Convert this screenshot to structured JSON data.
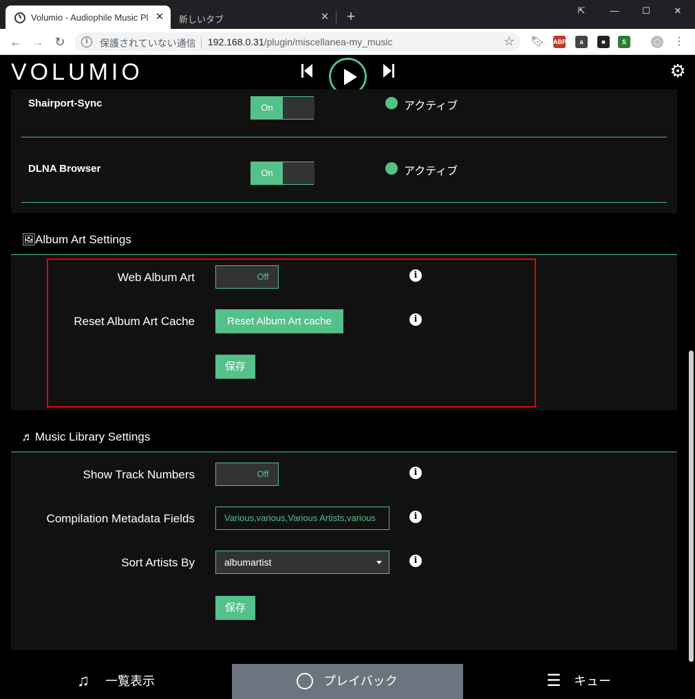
{
  "browser": {
    "tabs": [
      {
        "title": "Volumio - Audiophile Music Pl",
        "active": true
      },
      {
        "title": "新しいタブ",
        "active": false
      }
    ],
    "window_controls": {
      "cast": "⇱",
      "minimize": "—",
      "maximize": "☐",
      "close": "✕"
    },
    "address": {
      "security_label": "保護されていない通信",
      "host": "192.168.0.31",
      "path": "/plugin/miscellanea-my_music"
    },
    "extensions": [
      {
        "name": "abp-icon",
        "label": "ABP",
        "color": "#c0392b"
      },
      {
        "name": "amazon-icon",
        "label": "a",
        "color": "#444444"
      },
      {
        "name": "extension-dark-icon",
        "label": "■",
        "color": "#222222"
      },
      {
        "name": "s-extension-icon",
        "label": "S",
        "color": "#2e7d32"
      },
      {
        "name": "profile-icon",
        "label": "◯",
        "color": "#bdbdbd"
      }
    ]
  },
  "app": {
    "logo": "VOLUMIO",
    "accent": "#54c08a"
  },
  "services": [
    {
      "name": "Shairport-Sync",
      "toggle": "On",
      "status": "アクティブ"
    },
    {
      "name": "DLNA Browser",
      "toggle": "On",
      "status": "アクティブ"
    }
  ],
  "album_art": {
    "title": "Album Art Settings",
    "web_album_art": {
      "label": "Web Album Art",
      "toggle": "Off"
    },
    "reset_cache": {
      "label": "Reset Album Art Cache",
      "button": "Reset Album Art cache"
    },
    "save": "保存"
  },
  "music_library": {
    "title": "Music Library Settings",
    "show_track_numbers": {
      "label": "Show Track Numbers",
      "toggle": "Off"
    },
    "compilation": {
      "label": "Compilation Metadata Fields",
      "value": "Various,various,Various Artists,various"
    },
    "sort_artists": {
      "label": "Sort Artists By",
      "value": "albumartist"
    },
    "save": "保存"
  },
  "footer": {
    "browse": "一覧表示",
    "playback": "プレイバック",
    "queue": "キュー",
    "active": "playback"
  }
}
